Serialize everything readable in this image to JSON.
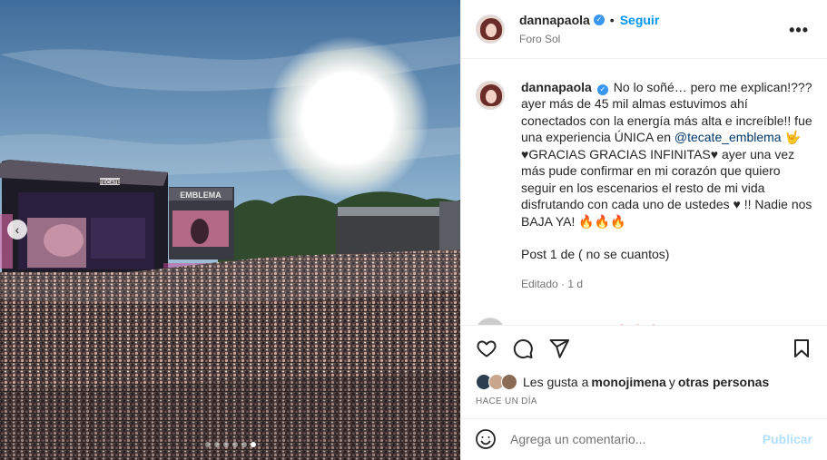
{
  "header": {
    "username": "dannapaola",
    "follow_label": "Seguir",
    "separator": "•",
    "location": "Foro Sol",
    "more_label": "•••"
  },
  "media": {
    "stage_sign_left": "TECATE",
    "stage_sign_right": "EMBLEMA",
    "dots_count": 6,
    "active_dot": 5
  },
  "caption": {
    "username": "dannapaola",
    "text_1": "No lo soñé… pero me explican!??? ayer más de 45 mil almas estuvimos ahí conectados con la energía más alta e increíble!! fue una experiencia ÚNICA en ",
    "mention": "@tecate_emblema",
    "text_2": " 🤟 ♥GRACIAS GRACIAS INFINITAS♥ ayer una vez más pude confirmar en mi corazón que quiero seguir en los escenarios el resto de mi vida disfrutando con cada uno de ustedes ♥ !! Nadie nos BAJA YA! 🔥🔥🔥",
    "post_number": "Post 1 de ( no se cuantos)",
    "edited": "Editado · 1 d"
  },
  "next_comment": {
    "username": "manolocaro",
    "emojis": "🔥🔥🔥"
  },
  "likes": {
    "prefix": "Les gusta a",
    "user": "monojimena",
    "conjunction": "y",
    "others": "otras personas"
  },
  "time": "HACE UN DÍA",
  "comment_box": {
    "placeholder": "Agrega un comentario...",
    "publish_label": "Publicar"
  },
  "colors": {
    "accent": "#0095f6",
    "publish_disabled": "#b2dffc",
    "secondary_text": "#737373",
    "border": "#efefef"
  }
}
